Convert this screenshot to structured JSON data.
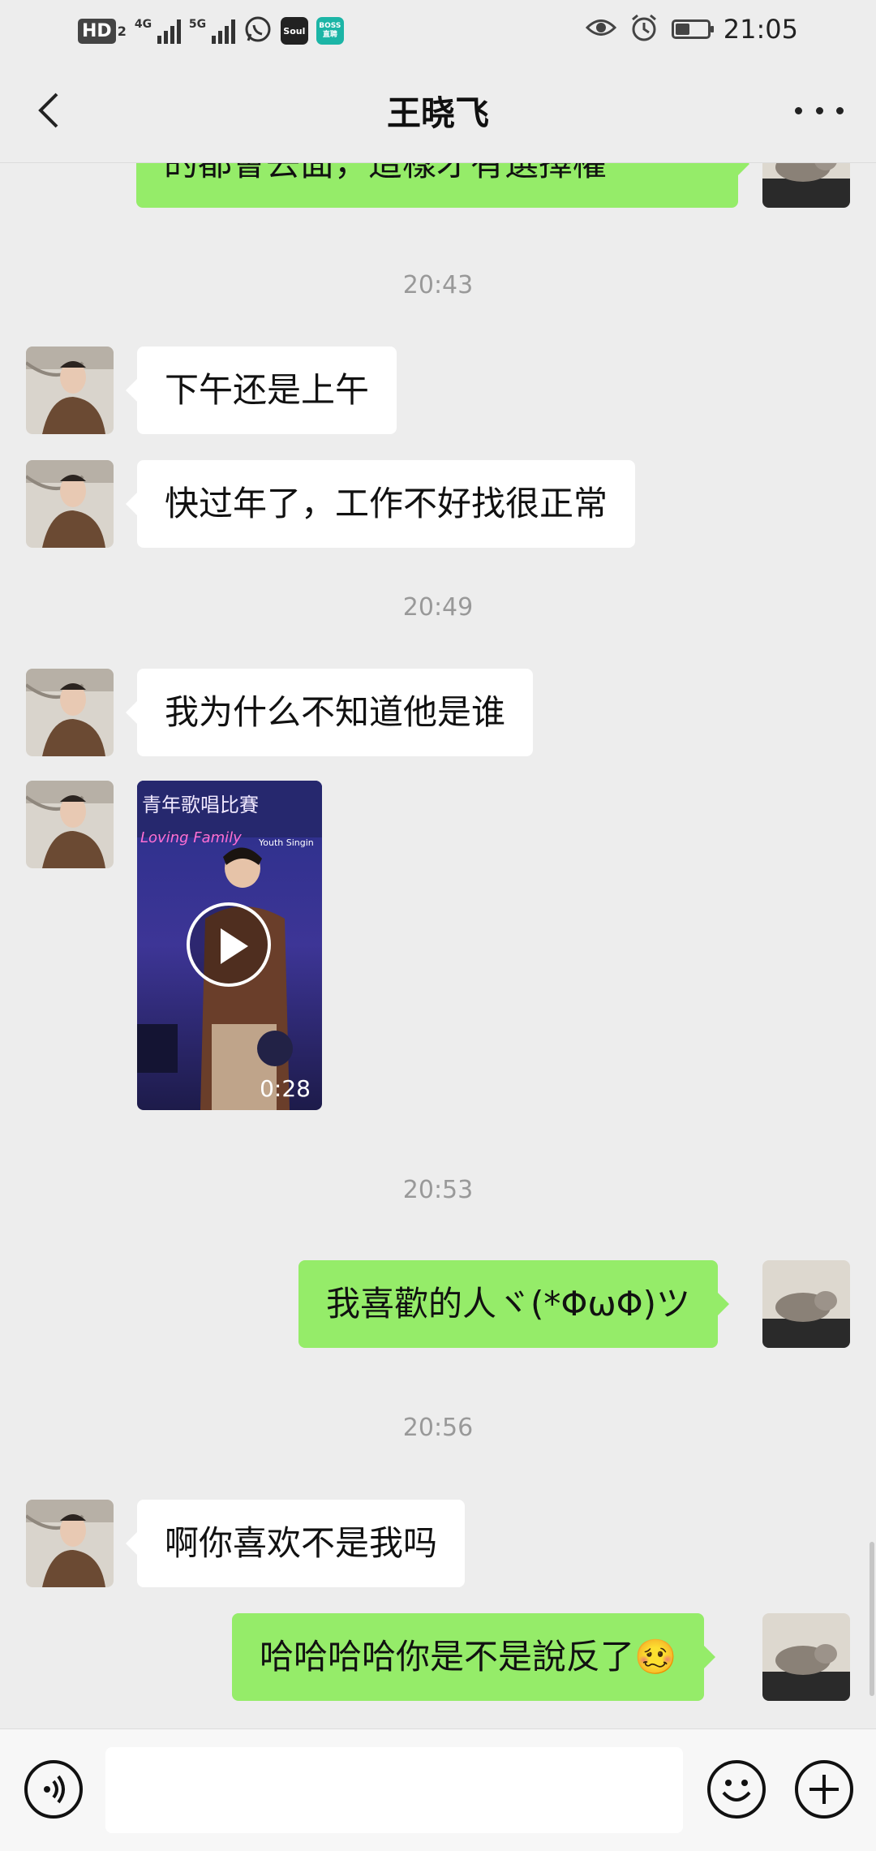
{
  "status_bar": {
    "hd": "HD",
    "hd_sub": "2",
    "net1": "4G",
    "net2": "5G",
    "soul": "Soul",
    "boss": "BOSS直聘",
    "time": "21:05",
    "battery_level": 0.45
  },
  "nav": {
    "title": "王晓飞"
  },
  "messages": {
    "m0": "的都會去面，這樣才有選擇權",
    "t1": "20:43",
    "m1": "下午还是上午",
    "m2": "快过年了，工作不好找很正常",
    "t2": "20:49",
    "m3": "我为什么不知道他是谁",
    "video_duration": "0:28",
    "video_banner_top": "青年歌唱比賽",
    "video_banner_sub": "Loving Family",
    "video_banner_sub2": "Youth Singin",
    "t3": "20:53",
    "m4": "我喜歡的人ヾ(*ΦωΦ)ツ",
    "t4": "20:56",
    "m5": "啊你喜欢不是我吗",
    "m6": "哈哈哈哈你是不是說反了",
    "m6_emoji": "🥴"
  },
  "colors": {
    "background": "#ededed",
    "outgoing_bubble": "#95ec69",
    "incoming_bubble": "#ffffff",
    "timestamp": "#999999"
  },
  "icons": {
    "back": "chevron-left-icon",
    "more": "more-dots-icon",
    "voice": "voice-icon",
    "emoji": "emoji-icon",
    "plus": "plus-icon",
    "play": "play-icon"
  }
}
